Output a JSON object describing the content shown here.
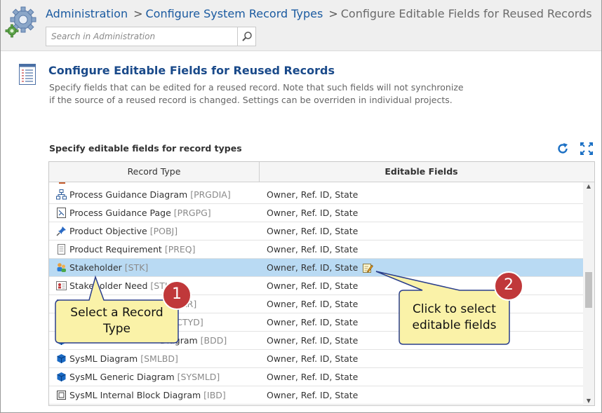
{
  "breadcrumb": {
    "admin": "Administration",
    "sep1": ">",
    "configure": "Configure System Record Types",
    "sep2": ">",
    "current": "Configure Editable Fields for Reused Records"
  },
  "search": {
    "placeholder": "Search in Administration"
  },
  "page": {
    "title": "Configure Editable Fields for Reused Records",
    "description": "Specify fields that can be edited for a reused record. Note that such fields will not synchronize if the source of a reused record is changed. Settings can be overriden in individual projects.",
    "section_label": "Specify editable fields for record types"
  },
  "grid": {
    "col_record_type": "Record Type",
    "col_editable_fields": "Editable Fields",
    "rows": [
      {
        "name": "Process Guidance Diagram",
        "code": "[PRGDIA]",
        "fields": "Owner, Ref. ID, State"
      },
      {
        "name": "Process Guidance Page",
        "code": "[PRGPG]",
        "fields": "Owner, Ref. ID, State"
      },
      {
        "name": "Product Objective",
        "code": "[POBJ]",
        "fields": "Owner, Ref. ID, State"
      },
      {
        "name": "Product Requirement",
        "code": "[PREQ]",
        "fields": "Owner, Ref. ID, State"
      },
      {
        "name": "Stakeholder",
        "code": "[STK]",
        "fields": "Owner, Ref. ID, State"
      },
      {
        "name": "Stakeholder Need",
        "code": "[STK",
        "fields": "Owner, Ref. ID, State"
      },
      {
        "name": "",
        "code": "[STKR]",
        "fields": "Owner, Ref. ID, State"
      },
      {
        "name": "",
        "code": "[ACTYD]",
        "fields": "Owner, Ref. ID, State"
      },
      {
        "name": "Diagram",
        "code": "[BDD]",
        "fields": "Owner, Ref. ID, State"
      },
      {
        "name": "SysML Diagram",
        "code": "[SMLBD]",
        "fields": "Owner, Ref. ID, State"
      },
      {
        "name": "SysML Generic Diagram",
        "code": "[SYSMLD]",
        "fields": "Owner, Ref. ID, State"
      },
      {
        "name": "SysML Internal Block Diagram",
        "code": "[IBD]",
        "fields": "Owner, Ref. ID, State"
      }
    ]
  },
  "callouts": {
    "one": {
      "number": "1",
      "text_line1": "Select a Record",
      "text_line2": "Type"
    },
    "two": {
      "number": "2",
      "text_line1": "Click to select",
      "text_line2": "editable fields"
    }
  },
  "colors": {
    "link": "#1a5aa0",
    "title": "#1a4a8a",
    "selected_row": "#b9daf3",
    "callout_fill": "#faf2a8",
    "callout_border": "#2a3e8c",
    "badge": "#c0383a"
  },
  "icons": [
    "gear-icon",
    "search-icon",
    "list-page-icon",
    "refresh-icon",
    "expand-icon",
    "edit-icon"
  ]
}
